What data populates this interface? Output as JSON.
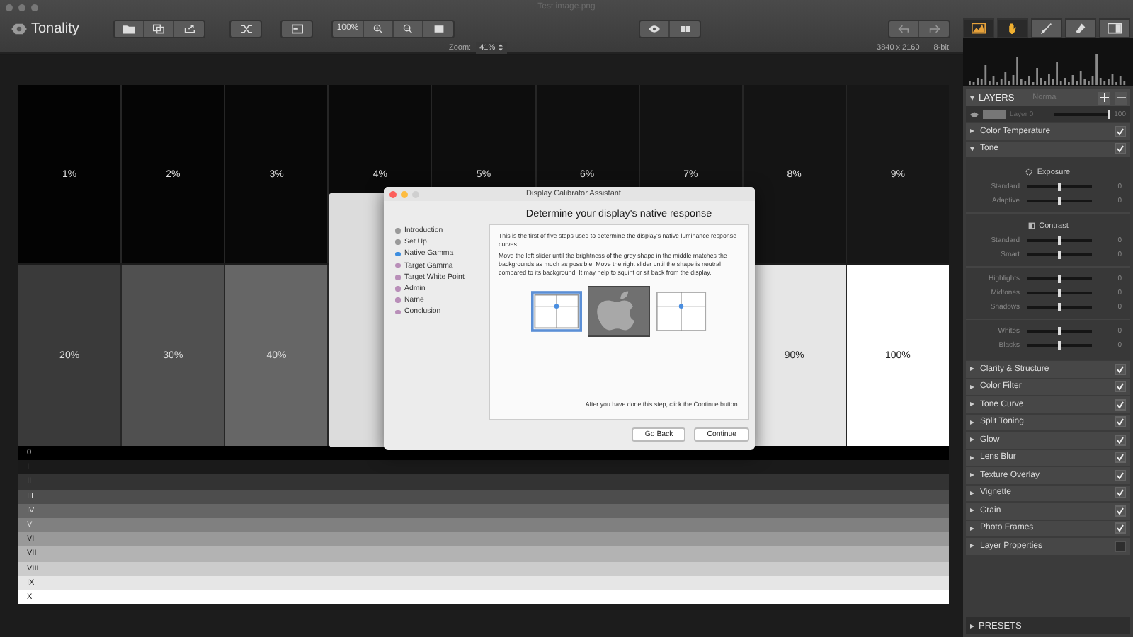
{
  "window": {
    "title": "Test image.png"
  },
  "app": {
    "name": "Tonality"
  },
  "toolbar": {
    "zoom_button": "100%",
    "tools": [
      {
        "kind": "histogram",
        "selected": true
      },
      {
        "kind": "hand",
        "selected": true
      },
      {
        "kind": "brush",
        "selected": false
      },
      {
        "kind": "eraser",
        "selected": false
      },
      {
        "kind": "panel",
        "selected": false
      }
    ]
  },
  "zoom_bar": {
    "label": "Zoom:",
    "value": "41%",
    "dimensions": "3840 x 2160",
    "bit_depth": "8-bit"
  },
  "canvas": {
    "top_row": [
      {
        "label": "1%",
        "color": "#030303"
      },
      {
        "label": "2%",
        "color": "#050505"
      },
      {
        "label": "3%",
        "color": "#080808"
      },
      {
        "label": "4%",
        "color": "#0a0a0a"
      },
      {
        "label": "5%",
        "color": "#0d0d0d"
      },
      {
        "label": "6%",
        "color": "#0f0f0f"
      },
      {
        "label": "7%",
        "color": "#121212"
      },
      {
        "label": "8%",
        "color": "#141414"
      },
      {
        "label": "9%",
        "color": "#171717"
      }
    ],
    "bottom_row_left": [
      {
        "label": "20%",
        "color": "#3a3a3a"
      },
      {
        "label": "30%",
        "color": "#505050"
      },
      {
        "label": "40%",
        "color": "#666666"
      }
    ],
    "bottom_row_right": [
      {
        "label": "90%",
        "color": "#e6e6e6"
      },
      {
        "label": "100%",
        "color": "#ffffff"
      }
    ],
    "zones": [
      {
        "label": "0",
        "color": "#000000"
      },
      {
        "label": "I",
        "color": "#1a1a1a"
      },
      {
        "label": "II",
        "color": "#333333"
      },
      {
        "label": "III",
        "color": "#4d4d4d"
      },
      {
        "label": "IV",
        "color": "#666666"
      },
      {
        "label": "V",
        "color": "#808080"
      },
      {
        "label": "VI",
        "color": "#999999"
      },
      {
        "label": "VII",
        "color": "#b3b3b3"
      },
      {
        "label": "VIII",
        "color": "#cccccc"
      },
      {
        "label": "IX",
        "color": "#e6e6e6"
      },
      {
        "label": "X",
        "color": "#ffffff"
      }
    ]
  },
  "dialog": {
    "title": "Display Calibrator Assistant",
    "heading": "Determine your display's native response",
    "steps": [
      {
        "label": "Introduction",
        "completed": true,
        "selected": false
      },
      {
        "label": "Set Up",
        "completed": true,
        "selected": false
      },
      {
        "label": "Native Gamma",
        "completed": false,
        "selected": true
      },
      {
        "label": "Target Gamma",
        "completed": false,
        "selected": false
      },
      {
        "label": "Target White Point",
        "completed": false,
        "selected": false
      },
      {
        "label": "Admin",
        "completed": false,
        "selected": false
      },
      {
        "label": "Name",
        "completed": false,
        "selected": false
      },
      {
        "label": "Conclusion",
        "completed": false,
        "selected": false
      }
    ],
    "paragraphs": [
      "This is the first of five steps used to determine the display's native luminance response curves.",
      "Move the left slider until the brightness of the grey shape in the middle matches the backgrounds as much as possible.  Move the right slider until the shape is neutral compared to its background.  It may help to squint or sit back from the display."
    ],
    "hint": "After you have done this step, click the Continue button.",
    "buttons": [
      "Go Back",
      "Continue"
    ]
  },
  "layers": {
    "title": "LAYERS",
    "blend_mode": "Normal",
    "layer": {
      "name": "Layer 0",
      "level": 1.0,
      "reading": "100"
    }
  },
  "adjustments": [
    {
      "title": "Color Temperature",
      "checked": true,
      "expanded": false
    },
    {
      "title": "Tone",
      "checked": true,
      "expanded": true,
      "groups": [
        {
          "kind": "exposure",
          "title": "Exposure",
          "sliders": [
            {
              "label": "Standard",
              "level": 0.5,
              "reading": "0"
            },
            {
              "label": "Adaptive",
              "level": 0.5,
              "reading": "0"
            }
          ]
        },
        {
          "kind": "contrast",
          "title": "Contrast",
          "sliders": [
            {
              "label": "Standard",
              "level": 0.5,
              "reading": "0"
            },
            {
              "label": "Smart",
              "level": 0.5,
              "reading": "0"
            }
          ]
        },
        {
          "kind": "plain",
          "sliders": [
            {
              "label": "Highlights",
              "level": 0.5,
              "reading": "0"
            },
            {
              "label": "Midtones",
              "level": 0.5,
              "reading": "0"
            },
            {
              "label": "Shadows",
              "level": 0.5,
              "reading": "0"
            }
          ]
        },
        {
          "kind": "plain",
          "sliders": [
            {
              "label": "Whites",
              "level": 0.5,
              "reading": "0"
            },
            {
              "label": "Blacks",
              "level": 0.5,
              "reading": "0"
            }
          ]
        }
      ]
    },
    {
      "title": "Clarity & Structure",
      "checked": true,
      "expanded": false
    },
    {
      "title": "Color Filter",
      "checked": true,
      "expanded": false
    },
    {
      "title": "Tone Curve",
      "checked": true,
      "expanded": false
    },
    {
      "title": "Split Toning",
      "checked": true,
      "expanded": false
    },
    {
      "title": "Glow",
      "checked": true,
      "expanded": false
    },
    {
      "title": "Lens Blur",
      "checked": true,
      "expanded": false
    },
    {
      "title": "Texture Overlay",
      "checked": true,
      "expanded": false
    },
    {
      "title": "Vignette",
      "checked": true,
      "expanded": false
    },
    {
      "title": "Grain",
      "checked": true,
      "expanded": false
    },
    {
      "title": "Photo Frames",
      "checked": true,
      "expanded": false
    },
    {
      "title": "Layer Properties",
      "checked": false,
      "expanded": false
    }
  ],
  "presets": {
    "title": "PRESETS"
  }
}
